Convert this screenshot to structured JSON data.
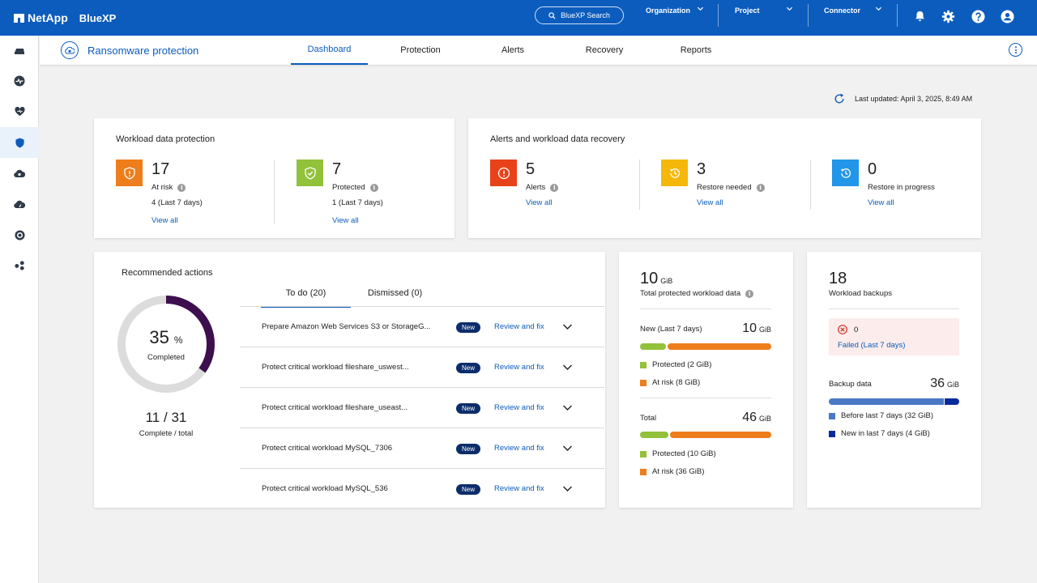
{
  "topbar": {
    "brand": "NetApp",
    "product": "BlueXP",
    "search_label": "BlueXP Search",
    "organization_label": "Organization",
    "project_label": "Project",
    "connector_label": "Connector"
  },
  "subheader": {
    "app_title": "Ransomware protection",
    "tabs": [
      {
        "label": "Dashboard",
        "active": true
      },
      {
        "label": "Protection",
        "active": false
      },
      {
        "label": "Alerts",
        "active": false
      },
      {
        "label": "Recovery",
        "active": false
      },
      {
        "label": "Reports",
        "active": false
      }
    ]
  },
  "last_updated": "Last updated: April 3, 2025, 8:49 AM",
  "workload_protection": {
    "title": "Workload data protection",
    "at_risk": {
      "value": "17",
      "label": "At risk",
      "sub": "4 (Last 7 days)",
      "link": "View all"
    },
    "protected": {
      "value": "7",
      "label": "Protected",
      "sub": "1 (Last 7 days)",
      "link": "View all"
    }
  },
  "alerts_recovery": {
    "title": "Alerts and workload data recovery",
    "alerts": {
      "value": "5",
      "label": "Alerts",
      "link": "View all"
    },
    "restore_needed": {
      "value": "3",
      "label": "Restore needed",
      "link": "View all"
    },
    "restore_in_progress": {
      "value": "0",
      "label": "Restore in progress",
      "link": "View all"
    }
  },
  "recommended": {
    "title": "Recommended actions",
    "percent": "35",
    "percent_sign": "%",
    "percent_value": 35,
    "completed_label": "Completed",
    "done": "11",
    "slash": "/",
    "total": "31",
    "ratio_label": "Complete / total",
    "tabs": [
      {
        "label": "To do (20)",
        "active": true
      },
      {
        "label": "Dismissed (0)",
        "active": false
      }
    ],
    "rows": [
      {
        "task": "Prepare Amazon Web Services S3 or StorageG...",
        "badge": "New",
        "link": "Review and fix"
      },
      {
        "task": "Protect critical workload fileshare_uswest...",
        "badge": "New",
        "link": "Review and fix"
      },
      {
        "task": "Protect critical workload fileshare_useast...",
        "badge": "New",
        "link": "Review and fix"
      },
      {
        "task": "Protect critical workload MySQL_7306",
        "badge": "New",
        "link": "Review and fix"
      },
      {
        "task": "Protect critical workload MySQL_536",
        "badge": "New",
        "link": "Review and fix"
      }
    ]
  },
  "protected_data": {
    "total_value": "10",
    "unit": "GiB",
    "total_label": "Total protected workload data",
    "new_label": "New (Last 7 days)",
    "new_value": "10",
    "new_protected_gib": 2,
    "new_at_risk_gib": 8,
    "new_protected_label": "Protected  (2 GiB)",
    "new_at_risk_label": "At risk  (8 GiB)",
    "all_label": "Total",
    "all_value": "46",
    "all_protected_gib": 10,
    "all_at_risk_gib": 36,
    "all_protected_label": "Protected  (10 GiB)",
    "all_at_risk_label": "At risk  (36 GiB)"
  },
  "backups": {
    "value": "18",
    "label": "Workload backups",
    "failed_count": "0",
    "failed_link": "Failed (Last 7 days)",
    "backup_data_label": "Backup data",
    "backup_data_value": "36",
    "unit": "GiB",
    "before_gib": 32,
    "new_gib": 4,
    "before_label": "Before last 7 days  (32 GiB)",
    "new_label": "New in last 7 days  (4 GiB)"
  },
  "colors": {
    "brand_blue": "#0b5cbd",
    "at_risk_orange": "#ee7d1b",
    "protected_green": "#92c13a",
    "alert_red": "#e8421a",
    "restore_yellow": "#f5b80a",
    "in_progress_blue": "#2296e8",
    "donut_purple": "#3e0f4f",
    "backup_before": "#4a78c8",
    "backup_new": "#0b2a9a"
  }
}
